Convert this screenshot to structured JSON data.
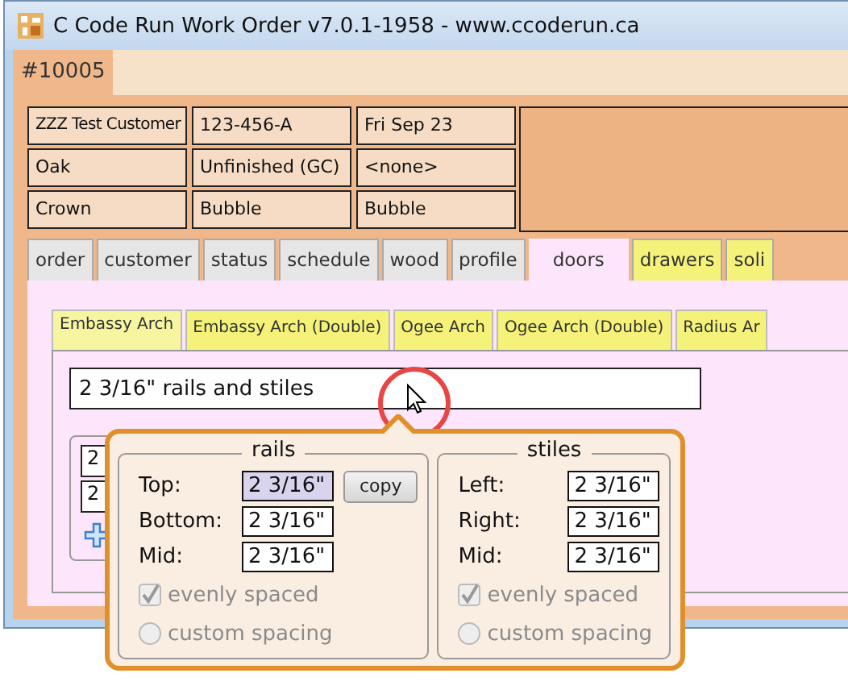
{
  "window": {
    "title": "C Code Run Work Order v7.0.1-1958 - www.ccoderun.ca"
  },
  "order_tabs": [
    {
      "label": "#10005",
      "selected": true
    }
  ],
  "info_grid": [
    [
      "ZZZ Test Customer",
      "123-456-A",
      "Fri Sep 23"
    ],
    [
      "Oak",
      "Unfinished (GC)",
      "<none>"
    ],
    [
      "Crown",
      "Bubble",
      "Bubble"
    ]
  ],
  "tabs": [
    {
      "label": "order",
      "selected": false,
      "color": "#e6e6e6"
    },
    {
      "label": "customer",
      "selected": false,
      "color": "#e6e6e6"
    },
    {
      "label": "status",
      "selected": false,
      "color": "#e6e6e6"
    },
    {
      "label": "schedule",
      "selected": false,
      "color": "#e6e6e6"
    },
    {
      "label": "wood",
      "selected": false,
      "color": "#e6e6e6"
    },
    {
      "label": "profile",
      "selected": false,
      "color": "#e6e6e6"
    },
    {
      "label": "doors",
      "selected": true,
      "color": "#fde6fb"
    },
    {
      "label": "drawers",
      "selected": false,
      "color": "#f5f27a"
    },
    {
      "label": "soli",
      "selected": false,
      "color": "#f5f27a"
    }
  ],
  "door_tabs": [
    {
      "label": "Embassy Arch",
      "selected": true
    },
    {
      "label": "Embassy Arch (Double)",
      "selected": false
    },
    {
      "label": "Ogee Arch",
      "selected": false
    },
    {
      "label": "Ogee Arch (Double)",
      "selected": false
    },
    {
      "label": "Radius Ar",
      "selected": false
    }
  ],
  "description_field": {
    "value": "2 3/16\" rails and stiles"
  },
  "size_group": {
    "fields": [
      "2",
      "2"
    ]
  },
  "popup": {
    "groups": [
      {
        "title": "rails",
        "copy_button": "copy",
        "rows": [
          {
            "label": "Top:",
            "value": "2 3/16\"",
            "selected": true
          },
          {
            "label": "Bottom:",
            "value": "2 3/16\"",
            "selected": false
          },
          {
            "label": "Mid:",
            "value": "2 3/16\"",
            "selected": false
          }
        ],
        "options": [
          {
            "kind": "checkbox",
            "label": "evenly spaced",
            "checked": true,
            "disabled": true
          },
          {
            "kind": "radio",
            "label": "custom spacing",
            "checked": false,
            "disabled": true
          }
        ]
      },
      {
        "title": "stiles",
        "rows": [
          {
            "label": "Left:",
            "value": "2 3/16\"",
            "selected": false
          },
          {
            "label": "Right:",
            "value": "2 3/16\"",
            "selected": false
          },
          {
            "label": "Mid:",
            "value": "2 3/16\"",
            "selected": false
          }
        ],
        "options": [
          {
            "kind": "checkbox",
            "label": "evenly spaced",
            "checked": true,
            "disabled": true
          },
          {
            "kind": "radio",
            "label": "custom spacing",
            "checked": false,
            "disabled": true
          }
        ]
      }
    ]
  }
}
